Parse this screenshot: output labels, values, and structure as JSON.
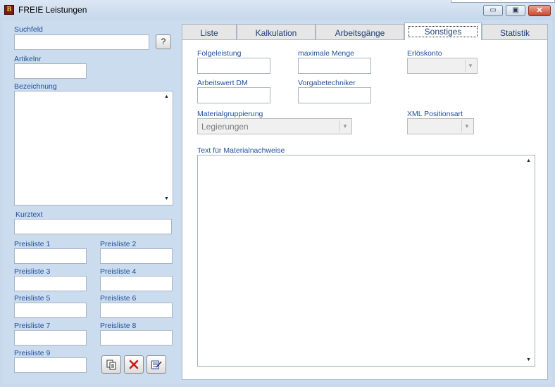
{
  "window": {
    "title": "FREIE Leistungen",
    "icon_text": "B",
    "buttons": {
      "minimize": "▭",
      "maximize": "▣",
      "close": "✕"
    }
  },
  "left": {
    "suchfeld": {
      "label": "Suchfeld",
      "value": "",
      "help_button": "?"
    },
    "artikelnr": {
      "label": "Artikelnr",
      "value": ""
    },
    "bezeichnung": {
      "label": "Bezeichnung",
      "value": ""
    },
    "kurztext": {
      "label": "Kurztext",
      "value": ""
    },
    "preislisten": [
      {
        "label": "Preisliste 1",
        "value": ""
      },
      {
        "label": "Preisliste 2",
        "value": ""
      },
      {
        "label": "Preisliste 3",
        "value": ""
      },
      {
        "label": "Preisliste 4",
        "value": ""
      },
      {
        "label": "Preisliste 5",
        "value": ""
      },
      {
        "label": "Preisliste 6",
        "value": ""
      },
      {
        "label": "Preisliste 7",
        "value": ""
      },
      {
        "label": "Preisliste 8",
        "value": ""
      },
      {
        "label": "Preisliste 9",
        "value": ""
      }
    ],
    "actions": {
      "copy_icon": "copy-icon",
      "delete_icon": "delete-icon",
      "edit_icon": "edit-icon"
    }
  },
  "tabs": [
    {
      "label": "Liste",
      "active": false
    },
    {
      "label": "Kalkulation",
      "active": false
    },
    {
      "label": "Arbeitsgänge",
      "active": false
    },
    {
      "label": "Sonstiges",
      "active": true
    },
    {
      "label": "Statistik",
      "active": false
    }
  ],
  "sonstiges": {
    "folgeleistung": {
      "label": "Folgeleistung",
      "value": ""
    },
    "maximale_menge": {
      "label": "maximale Menge",
      "value": ""
    },
    "erloeskonto": {
      "label": "Erlöskonto",
      "value": ""
    },
    "arbeitswert": {
      "label": "Arbeitswert DM",
      "value": ""
    },
    "vorgabetechniker": {
      "label": "Vorgabetechniker",
      "value": ""
    },
    "materialgruppierung": {
      "label": "Materialgruppierung",
      "value": "Legierungen"
    },
    "xml_positionsart": {
      "label": "XML Positionsart",
      "value": ""
    },
    "text_material": {
      "label": "Text für Materialnachweise",
      "value": ""
    }
  },
  "colors": {
    "label_blue": "#1f4f9a",
    "window_bg": "#cbdcee",
    "close_red": "#c74a2f"
  }
}
